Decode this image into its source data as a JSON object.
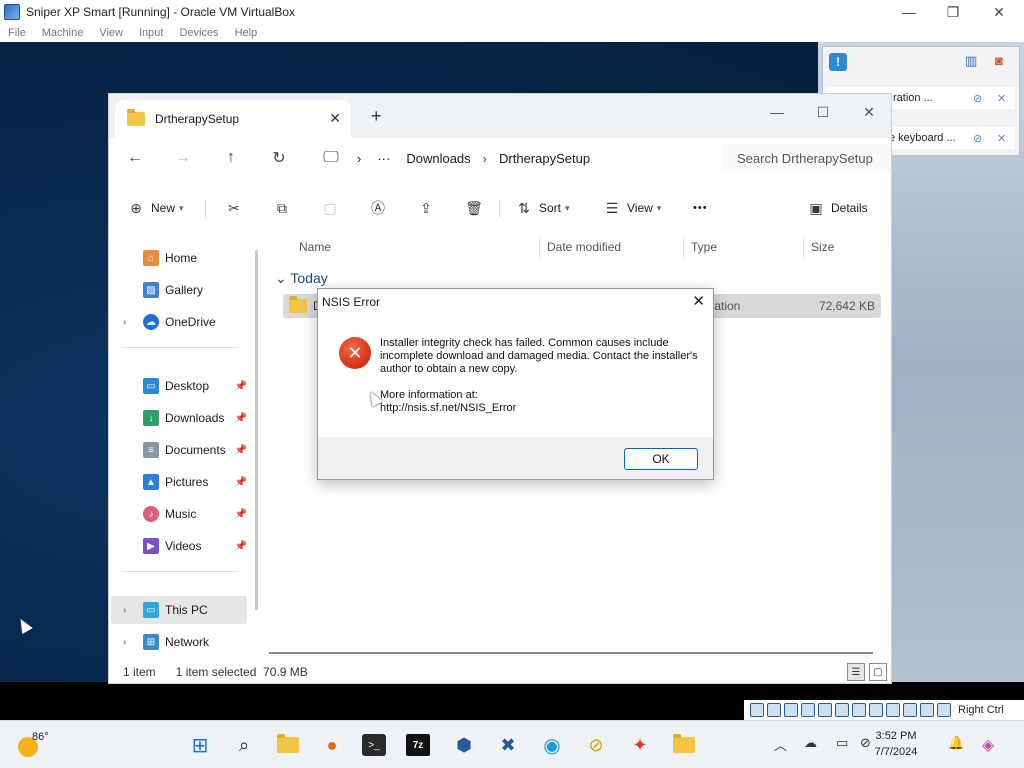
{
  "host": {
    "title": "Sniper XP Smart [Running] - Oracle VM VirtualBox",
    "menu": [
      "File",
      "Machine",
      "View",
      "Input",
      "Devices",
      "Help"
    ],
    "window_controls": {
      "minimize": "—",
      "restore": "❐",
      "close": "✕"
    },
    "notifications": [
      {
        "text": "ration ..."
      },
      {
        "text": "e keyboard ..."
      }
    ],
    "host_key": "Right Ctrl"
  },
  "explorer": {
    "tab_title": "DrtherapySetup",
    "new_tab": "+",
    "path": [
      "Downloads",
      "DrtherapySetup"
    ],
    "search_placeholder": "Search DrtherapySetup",
    "commands": {
      "new": "New",
      "sort": "Sort",
      "view": "View",
      "more": "•••",
      "details": "Details"
    },
    "nav": {
      "home": "Home",
      "gallery": "Gallery",
      "onedrive": "OneDrive",
      "desktop": "Desktop",
      "downloads": "Downloads",
      "documents": "Documents",
      "pictures": "Pictures",
      "music": "Music",
      "videos": "Videos",
      "this_pc": "This PC",
      "network": "Network"
    },
    "columns": {
      "name": "Name",
      "date": "Date modified",
      "type": "Type",
      "size": "Size"
    },
    "group": "Today",
    "file": {
      "name": "Dr",
      "type": "lication",
      "size": "72,642 KB"
    },
    "status": {
      "count": "1 item",
      "selected": "1 item selected  70.9 MB"
    }
  },
  "dialog": {
    "title": "NSIS Error",
    "message": "Installer integrity check has failed. Common causes include incomplete download and damaged media. Contact the installer's author to obtain a new copy.",
    "more_label": "More information at:",
    "more_url": "http://nsis.sf.net/NSIS_Error",
    "ok_label": "OK"
  },
  "taskbar": {
    "temperature": "86°",
    "time": "3:52 PM",
    "date": "7/7/2024"
  }
}
